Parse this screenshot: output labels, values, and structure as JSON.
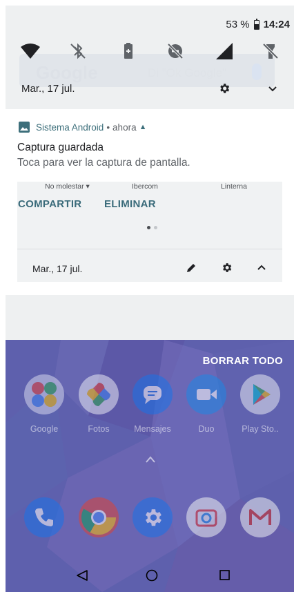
{
  "status_bar": {
    "battery_percent": "53 %",
    "time": "14:24",
    "battery_level": 0.53
  },
  "quick_settings": {
    "tiles": [
      "wifi-icon",
      "bluetooth-off-icon",
      "battery-saver-icon",
      "do-not-disturb-icon",
      "cellular-signal-icon",
      "flashlight-off-icon"
    ],
    "date": "Mar., 17 jul."
  },
  "background_search": {
    "logo": "Google",
    "hint": "Di \"Ok Google\""
  },
  "notification": {
    "app_name": "Sistema Android",
    "separator": "•",
    "time": "ahora",
    "title": "Captura guardada",
    "text": "Toca para ver la captura de pantalla.",
    "preview": {
      "labels": [
        "No molestar",
        "Ibercom",
        "Linterna"
      ],
      "date": "Mar., 17 jul."
    },
    "actions": {
      "share": "COMPARTIR",
      "delete": "ELIMINAR"
    }
  },
  "home": {
    "clear_all": "BORRAR TODO",
    "apps": [
      "Google",
      "Fotos",
      "Mensajes",
      "Duo",
      "Play Sto.."
    ]
  },
  "colors": {
    "accent": "#3d6f7b",
    "home_scrim": "#5e60ad"
  }
}
